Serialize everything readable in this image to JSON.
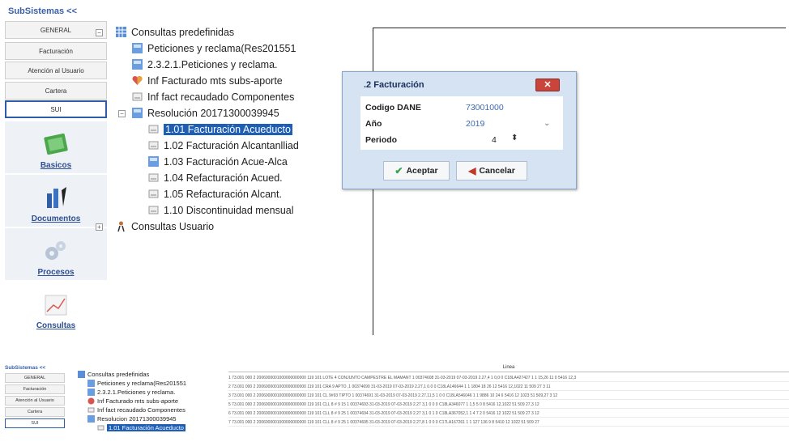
{
  "top": {
    "subsystems_title": "SubSistemas <<",
    "sidebar": {
      "buttons": [
        "GENERAL",
        "Facturación",
        "Atención al Usuario",
        "Cartera",
        "SUI"
      ],
      "sections": [
        "Basicos",
        "Documentos",
        "Procesos",
        "Consultas"
      ]
    },
    "tree": {
      "root": "Consultas predefinidas",
      "items": [
        "Peticiones y reclama(Res201551",
        "2.3.2.1.Peticiones y reclama.",
        "Inf Facturado mts subs-aporte",
        "Inf fact recaudado Componentes",
        "Resolución 20171300039945",
        "1.01 Facturación Acueducto",
        "1.02 Facturación Alcantanlliad",
        "1.03 Facturación Acue-Alca",
        "1.04 Refacturación Acued.",
        "1.05 Refacturación Alcant.",
        "1.10 Discontinuidad mensual",
        "Consultas Usuario"
      ]
    },
    "dialog": {
      "title": ".2 Facturación",
      "close": "✕",
      "fields": {
        "codigo_label": "Codigo DANE",
        "codigo_value": "73001000",
        "anio_label": "Año",
        "anio_value": "2019",
        "periodo_label": "Periodo",
        "periodo_value": "4"
      },
      "accept": "Aceptar",
      "cancel": "Cancelar"
    }
  },
  "bottom": {
    "subsystems_title": "SubSistemas <<",
    "sidebar_buttons": [
      "GENERAL",
      "Facturación",
      "Atención al Usuario",
      "Cartera",
      "SUI"
    ],
    "tree": [
      "Consultas predefinidas",
      "Peticiones y reclama(Res201551",
      "2.3.2.1.Peticiones y reclama.",
      "Inf Facturado mts subs-aporte",
      "Inf fact recaudado Componentes",
      "Resolucion 20171300039945",
      "1.01 Facturación Acueducto"
    ],
    "table_header": "Linea",
    "rows": [
      "1 73.001 000 2 2006000001000000000000 119 101 LOTE 4 CONJUNTO CAMPESTRE EL MAMANT 1 00374608 31-03-2019 07-03-2019 2.27,4 1 0,0 0 C18LA427427 1 1 15,26 11 0 5416 12,3",
      "2 73.001 000 2 2006000001000000000000 119 101 CRA 9 APTO ,1 00374690 31-03-2019 07-03-2019 2.27,1 0.0 0 C18LA146644 1 1 1804 18 26 12 5416 12,1022 11 509 27 3 11",
      "3 73.001 000 2 2006000001000000000000 119 101 CL 9#93 TIPTO 1 00374691 31-03-2019 07-03-2019 2.27,11,5 1 0 0 C18LA546046 1 1 9886 10 24 6 5416 12 1023 51 509,27 3 12",
      "5 73.001 000 2 2006000001000000000000 119 101 CLL 8 # 9 15 1 00374693 31-03-2019 07-03-2019 2.27 3,1 0 0 0 C18LA346077 1 1,5 5 0 8 5416 12,1022 51 509 27,3 12",
      "6 73.001 000 2 2006000001000000000000 119 101 CLL 8 # 9 25 1 00374694 31-03-2019 07-03-2019 2.27 3,1 0 1 0 C18LA367052,1 1 4 7 2 0 5416 12 1022 51 509 27 3 12",
      "7 73.001 000 2 2006000001000000000000 119 101 CLL 8 # 9 25 1 00374695 31-03-2019 07-03-2019 2.27,8 1 0 0 0 C17LA167261 1 1 127 136 9 8 5410 12 1022 51 509 27"
    ]
  }
}
